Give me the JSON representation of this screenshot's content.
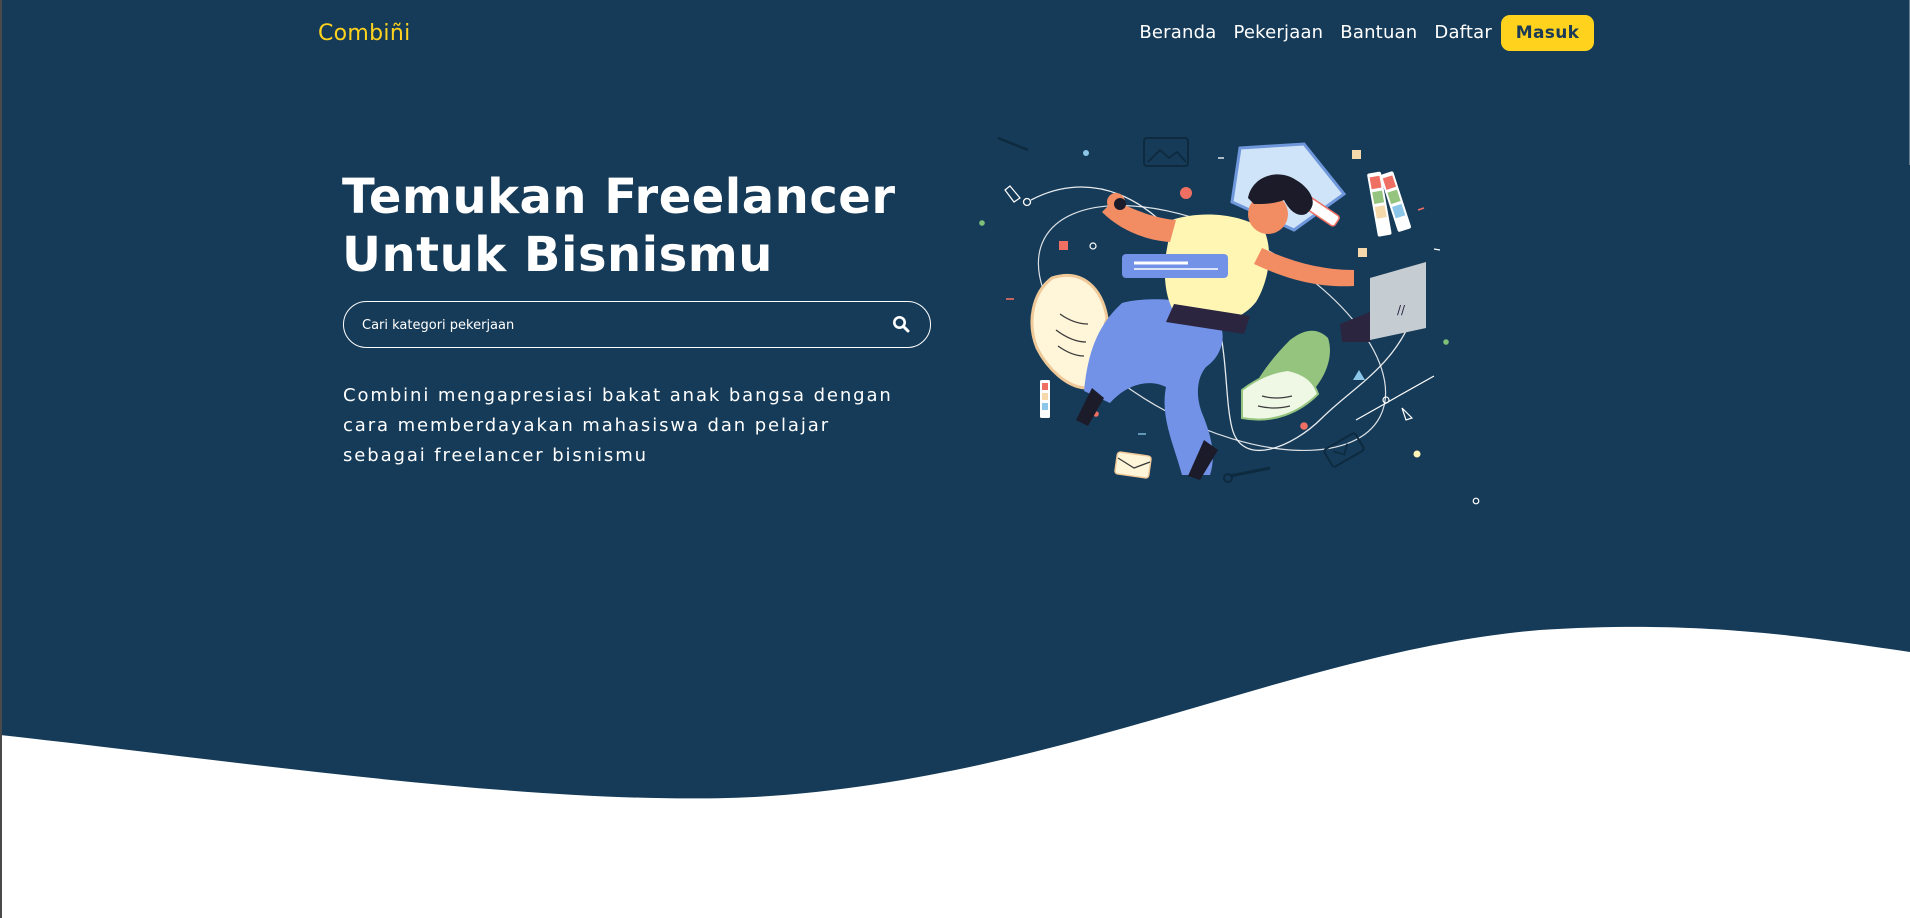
{
  "colors": {
    "hero_background": "#163b58",
    "accent_yellow": "#ffd21d",
    "text_white": "#ffffff"
  },
  "navbar": {
    "logo": "Combiñi",
    "links": [
      "Beranda",
      "Pekerjaan",
      "Bantuan",
      "Daftar"
    ],
    "login_label": "Masuk"
  },
  "hero": {
    "title_lines": [
      "Temukan Freelancer",
      "Untuk Bisnismu"
    ],
    "search": {
      "placeholder": "Cari kategori pekerjaan",
      "value": "",
      "icon": "search-icon"
    },
    "description_lines": [
      "Combini mengapresiasi bakat anak bangsa dengan",
      "cara memberdayakan mahasiswa dan pelajar",
      "sebagai freelancer bisnismu"
    ],
    "illustration": "freelancer-multitasking-illustration"
  }
}
